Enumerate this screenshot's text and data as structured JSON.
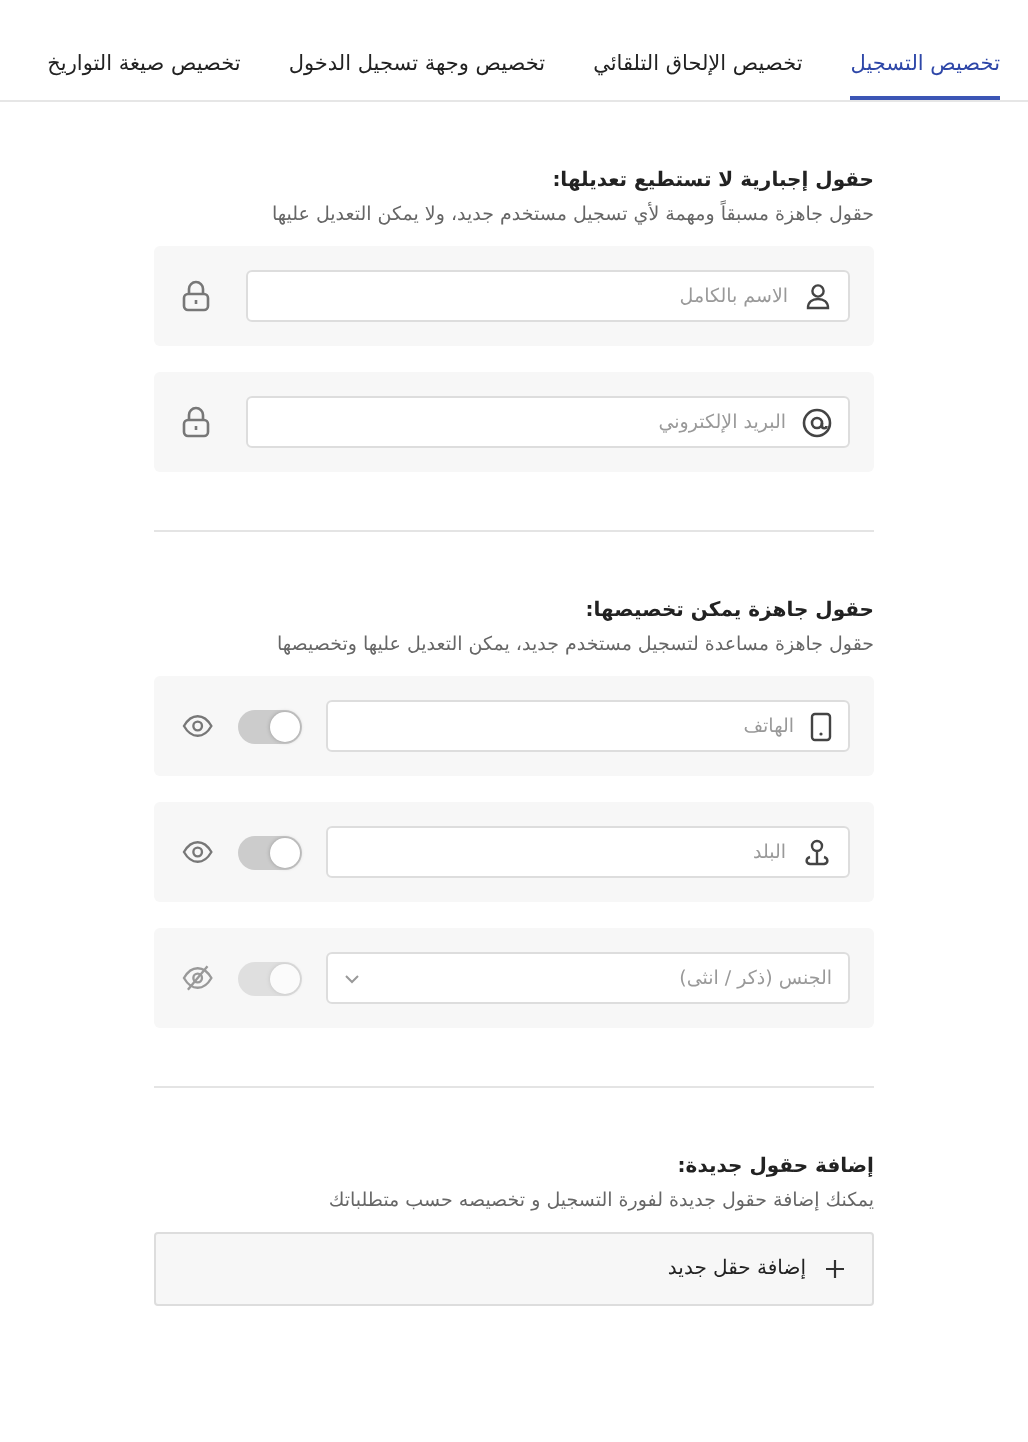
{
  "tabs": [
    {
      "label": "تخصيص التسجيل",
      "selected": true
    },
    {
      "label": "تخصيص الإلحاق التلقائي",
      "selected": false
    },
    {
      "label": "تخصيص وجهة تسجيل الدخول",
      "selected": false
    },
    {
      "label": "تخصيص صيغة التواريخ",
      "selected": false
    }
  ],
  "sections": [
    {
      "kind": "locked",
      "title": "حقول إجبارية لا تستطيع تعديلها:",
      "description": "حقول جاهزة مسبقاً ومهمة لأي تسجيل مستخدم جديد، ولا يمكن التعديل عليها",
      "fields": [
        {
          "kind": "name",
          "placeholder": "الاسم بالكامل"
        },
        {
          "kind": "email",
          "placeholder": "البريد الإلكتروني"
        }
      ]
    },
    {
      "kind": "optional",
      "title": "حقول جاهزة يمكن تخصيصها:",
      "description": "حقول جاهزة مساعدة لتسجيل مستخدم جديد، يمكن التعديل عليها وتخصيصها",
      "fields": [
        {
          "kind": "phone",
          "placeholder": "الهاتف",
          "on": true,
          "disabled": false,
          "visible": true
        },
        {
          "kind": "country",
          "placeholder": "البلد",
          "on": true,
          "disabled": false,
          "visible": true
        },
        {
          "kind": "select",
          "placeholder": "الجنس (ذكر / انثى)",
          "on": true,
          "disabled": true,
          "visible": false
        }
      ]
    },
    {
      "title": "إضافة حقول جديدة:",
      "description": "يمكنك إضافة حقول جديدة لفورة التسجيل و تخصيصه حسب متطلباتك",
      "add_button": "إضافة حقل جديد"
    }
  ]
}
